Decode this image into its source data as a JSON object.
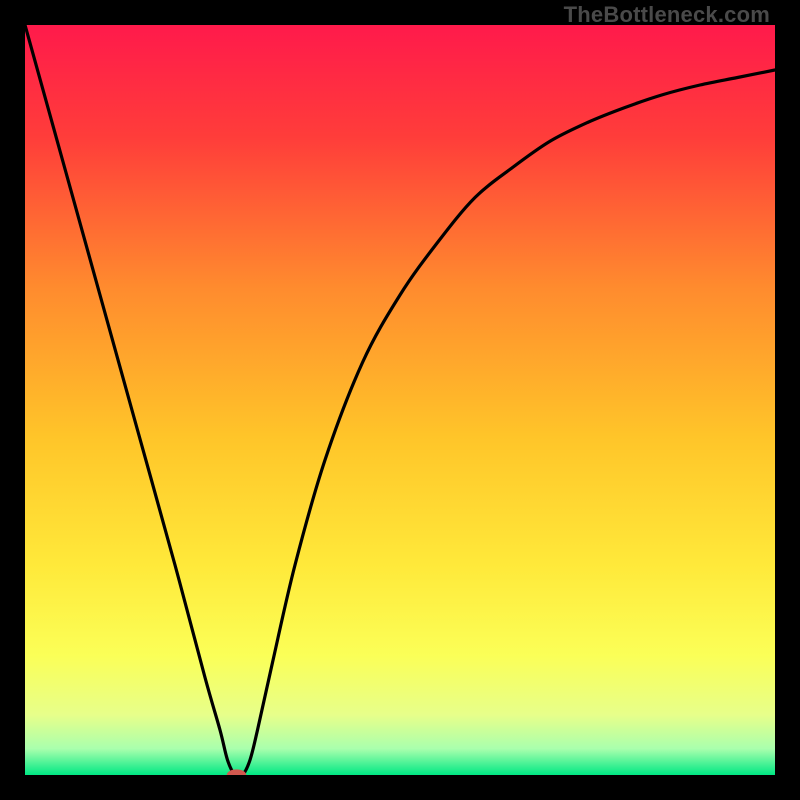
{
  "watermark": "TheBottleneck.com",
  "chart_data": {
    "type": "line",
    "title": "",
    "xlabel": "",
    "ylabel": "",
    "xlim": [
      0,
      100
    ],
    "ylim": [
      0,
      100
    ],
    "gradient_stops": [
      {
        "offset": 0.0,
        "color": "#ff1a4b"
      },
      {
        "offset": 0.15,
        "color": "#ff3d3a"
      },
      {
        "offset": 0.35,
        "color": "#ff8b2e"
      },
      {
        "offset": 0.55,
        "color": "#ffc529"
      },
      {
        "offset": 0.72,
        "color": "#ffe93a"
      },
      {
        "offset": 0.84,
        "color": "#fbff57"
      },
      {
        "offset": 0.92,
        "color": "#e7ff8a"
      },
      {
        "offset": 0.965,
        "color": "#a9ffad"
      },
      {
        "offset": 1.0,
        "color": "#00e884"
      }
    ],
    "series": [
      {
        "name": "bottleneck-curve",
        "x": [
          0,
          5,
          10,
          15,
          20,
          24,
          26,
          27,
          28,
          29,
          30,
          31,
          33,
          36,
          40,
          45,
          50,
          55,
          60,
          65,
          70,
          75,
          80,
          85,
          90,
          95,
          100
        ],
        "y": [
          100,
          82,
          64,
          46,
          28,
          13,
          6,
          2,
          0,
          0,
          2,
          6,
          15,
          28,
          42,
          55,
          64,
          71,
          77,
          81,
          84.5,
          87,
          89,
          90.7,
          92,
          93,
          94
        ]
      }
    ],
    "marker": {
      "x": 28.2,
      "y": 0,
      "rx": 1.3,
      "ry": 0.75,
      "color": "#d1584f"
    }
  }
}
